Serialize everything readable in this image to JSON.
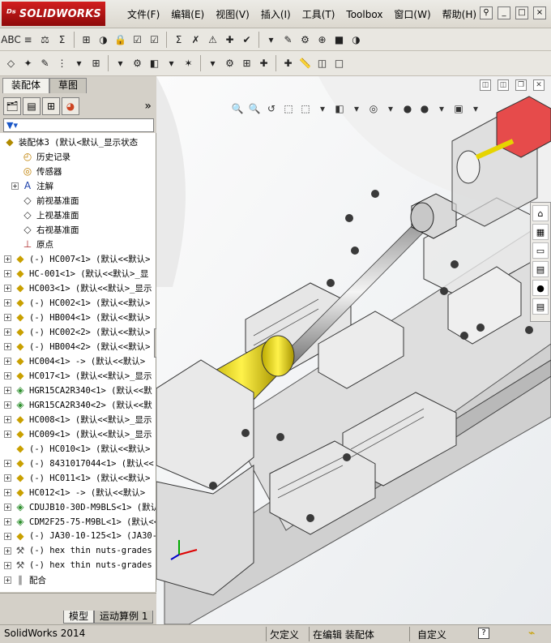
{
  "app": {
    "name": "SOLIDWORKS"
  },
  "menu": [
    "文件(F)",
    "编辑(E)",
    "视图(V)",
    "插入(I)",
    "工具(T)",
    "Toolbox",
    "窗口(W)",
    "帮助(H)"
  ],
  "title_controls": [
    "_",
    "□",
    "×"
  ],
  "toolbar_row1": [
    "ABC",
    "≡",
    "⚖",
    "Σ",
    "⊞",
    "◑",
    "🔒",
    "☑",
    "☑",
    "Σ",
    "✗",
    "⚠",
    "✚",
    "✔",
    "▾",
    "✎",
    "⚙",
    "⊕",
    "■",
    "◑"
  ],
  "toolbar_row2": [
    "◇",
    "✦",
    "✎",
    "⋮",
    "▾",
    "⊞",
    "▾",
    "⚙",
    "◧",
    "▾",
    "✶",
    "▾",
    "⚙",
    "⊞",
    "✚",
    "✚",
    "📏",
    "◫",
    "□"
  ],
  "feature_manager": {
    "tabs": [
      "装配体",
      "草图"
    ],
    "filter_symbol": "▼▾",
    "top_item": "装配体3  (默认<默认_显示状态",
    "items": [
      {
        "label": "历史记录",
        "expand": false,
        "icon": "history-icon"
      },
      {
        "label": "传感器",
        "expand": false,
        "icon": "sensor-icon"
      },
      {
        "label": "注解",
        "expand": true,
        "icon": "annotation-icon"
      },
      {
        "label": "前视基准面",
        "expand": false,
        "icon": "plane-icon"
      },
      {
        "label": "上视基准面",
        "expand": false,
        "icon": "plane-icon"
      },
      {
        "label": "右视基准面",
        "expand": false,
        "icon": "plane-icon"
      },
      {
        "label": "原点",
        "expand": false,
        "icon": "origin-icon"
      },
      {
        "label": "(-) HC007<1> (默认<<默认>",
        "expand": true,
        "icon": "part-icon"
      },
      {
        "label": "HC-001<1> (默认<<默认>_显",
        "expand": true,
        "icon": "part-icon"
      },
      {
        "label": "HC003<1> (默认<<默认>_显示",
        "expand": true,
        "icon": "part-icon"
      },
      {
        "label": "(-) HC002<1> (默认<<默认>",
        "expand": true,
        "icon": "part-icon"
      },
      {
        "label": "(-) HB004<1> (默认<<默认>",
        "expand": true,
        "icon": "part-icon"
      },
      {
        "label": "(-) HC002<2> (默认<<默认>",
        "expand": true,
        "icon": "part-icon"
      },
      {
        "label": "(-) HB004<2> (默认<<默认>",
        "expand": true,
        "icon": "part-icon"
      },
      {
        "label": "HC004<1> -> (默认<<默认>",
        "expand": true,
        "icon": "part-icon"
      },
      {
        "label": "HC017<1> (默认<<默认>_显示",
        "expand": true,
        "icon": "part-icon"
      },
      {
        "label": "HGR15CA2R340<1> (默认<<默",
        "expand": true,
        "icon": "subassembly-icon"
      },
      {
        "label": "HGR15CA2R340<2> (默认<<默",
        "expand": true,
        "icon": "subassembly-icon"
      },
      {
        "label": "HC008<1> (默认<<默认>_显示",
        "expand": true,
        "icon": "part-icon"
      },
      {
        "label": "HC009<1> (默认<<默认>_显示",
        "expand": true,
        "icon": "part-icon"
      },
      {
        "label": "(-) HC010<1> (默认<<默认>",
        "expand": false,
        "icon": "part-icon"
      },
      {
        "label": "(-) 8431017044<1> (默认<<",
        "expand": true,
        "icon": "part-icon"
      },
      {
        "label": "(-) HC011<1> (默认<<默认>",
        "expand": true,
        "icon": "part-icon"
      },
      {
        "label": "HC012<1> -> (默认<<默认>",
        "expand": true,
        "icon": "part-icon"
      },
      {
        "label": "CDUJB10-30D-M9BLS<1> (默认<",
        "expand": true,
        "icon": "subassembly-icon"
      },
      {
        "label": "CDM2F25-75-M9BL<1> (默认<<",
        "expand": true,
        "icon": "subassembly-icon"
      },
      {
        "label": "(-) JA30-10-125<1> (JA30-",
        "expand": true,
        "icon": "part-icon"
      },
      {
        "label": "(-) hex thin nuts-grades",
        "expand": true,
        "icon": "toolbox-part-icon"
      },
      {
        "label": "(-) hex thin nuts-grades",
        "expand": true,
        "icon": "toolbox-part-icon"
      },
      {
        "label": "配合",
        "expand": true,
        "icon": "mates-icon"
      }
    ],
    "bottom_tabs": [
      "模型",
      "运动算例 1"
    ]
  },
  "viewport": {
    "window_controls": [
      "◫",
      "◫",
      "❐",
      "✕"
    ],
    "hud_icons": [
      "🔍",
      "🔍",
      "↺",
      "⬚",
      "⬚",
      "▾",
      "◧",
      "▾",
      "◎",
      "▾",
      "●",
      "●",
      "▾",
      "▣",
      "▾"
    ],
    "taskpane_icons": [
      "⌂",
      "▦",
      "▭",
      "▤",
      "●",
      "▤"
    ]
  },
  "status": {
    "app": "SolidWorks 2014",
    "undefined": "欠定义",
    "editing": "在编辑 装配体",
    "custom": "自定义",
    "help": "?"
  },
  "colors": {
    "brand_red": "#c81a1a",
    "highlight_yellow": "#e6d400",
    "tree_bg": "#ffffff",
    "chrome": "#d4d0c8"
  }
}
